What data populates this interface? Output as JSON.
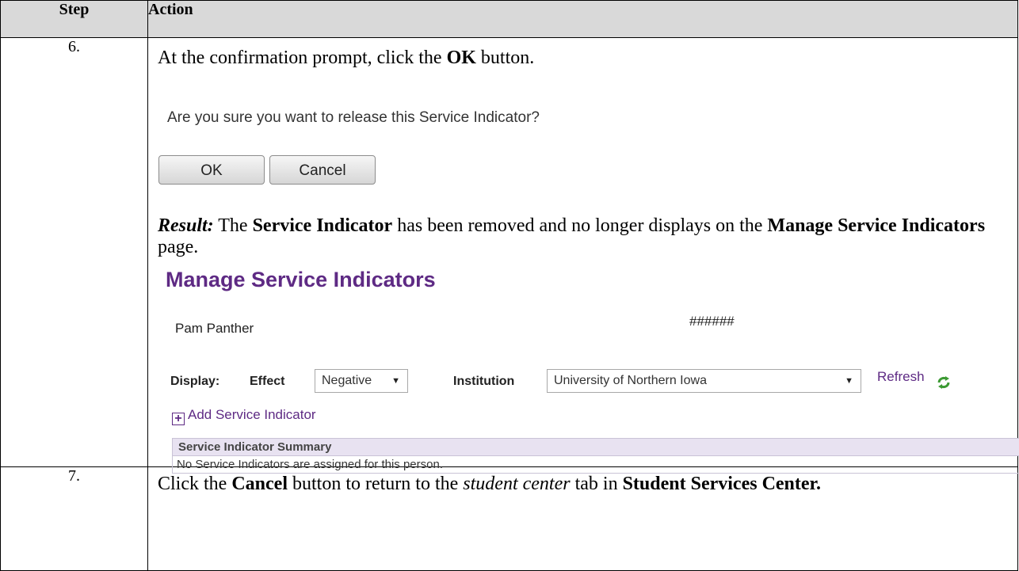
{
  "header": {
    "step": "Step",
    "action": "Action"
  },
  "step6": {
    "number": "6.",
    "instruction": {
      "pre": "At the confirmation prompt, click the ",
      "bold": "OK",
      "post": " button."
    },
    "prompt": "Are you sure you want to release this Service Indicator?",
    "ok_label": "OK",
    "cancel_label": "Cancel",
    "result": {
      "label": "Result:",
      "t1": "  The ",
      "b1": "Service Indicator",
      "t2": " has been removed and no longer displays on the ",
      "b2": "Manage Service Indicators",
      "t3": " page."
    },
    "page": {
      "title": "Manage Service Indicators",
      "name": "Pam Panther",
      "id": "######",
      "display_label": "Display:",
      "effect_label": "Effect",
      "effect_value": "Negative",
      "institution_label": "Institution",
      "institution_value": "University of Northern Iowa",
      "refresh_label": "Refresh",
      "add_label": "Add Service Indicator",
      "grid_title": "Service Indicator Summary",
      "grid_empty": "No Service Indicators are assigned for this person."
    }
  },
  "step7": {
    "number": "7.",
    "t1": "Click the ",
    "b1": "Cancel",
    "t2": " button to return to the ",
    "i1": "student center",
    "t3": " tab in ",
    "b2": "Student Services Center."
  },
  "colors": {
    "header_bg": "#d9d9d9",
    "peoplesoft_purple": "#5e2a84",
    "grid_header_bg": "#e8e2f1"
  },
  "icons": [
    "refresh-icon",
    "plus-box-icon",
    "chevron-down-icon"
  ]
}
